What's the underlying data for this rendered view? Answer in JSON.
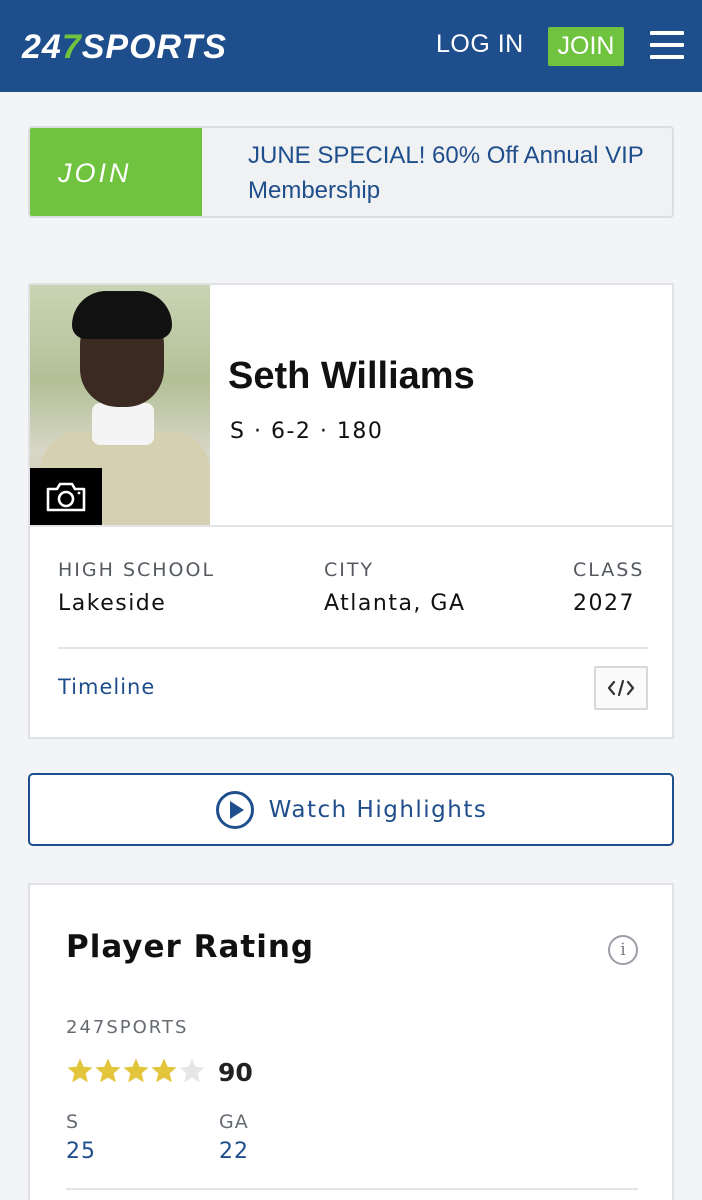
{
  "header": {
    "logo_prefix": "24",
    "logo_seven": "7",
    "logo_suffix": "SPORTS",
    "login_label": "LOG IN",
    "join_label": "JOIN",
    "brand_color": "#1f4e8c",
    "accent_color": "#6fc33f"
  },
  "promo": {
    "join_label": "JOIN",
    "text": "JUNE SPECIAL! 60% Off Annual VIP Membership"
  },
  "player": {
    "name": "Seth Williams",
    "meta": "S · 6-2 · 180",
    "high_school_label": "HIGH SCHOOL",
    "high_school": "Lakeside",
    "city_label": "CITY",
    "city": "Atlanta, GA",
    "class_label": "CLASS",
    "class_year": "2027",
    "timeline_label": "Timeline",
    "embed_icon": "code-embed-icon",
    "photo_icon": "camera-icon"
  },
  "highlights": {
    "label": "Watch Highlights",
    "icon": "play-circle-icon"
  },
  "rating": {
    "title": "Player Rating",
    "info_glyph": "i",
    "source": "247SPORTS",
    "stars_filled": 4,
    "stars_total": 5,
    "score": "90",
    "position_label": "S",
    "position_rank": "25",
    "state_label": "GA",
    "state_rank": "22",
    "star_color": "#e3c53b",
    "star_empty_color": "#e6e6e6"
  }
}
